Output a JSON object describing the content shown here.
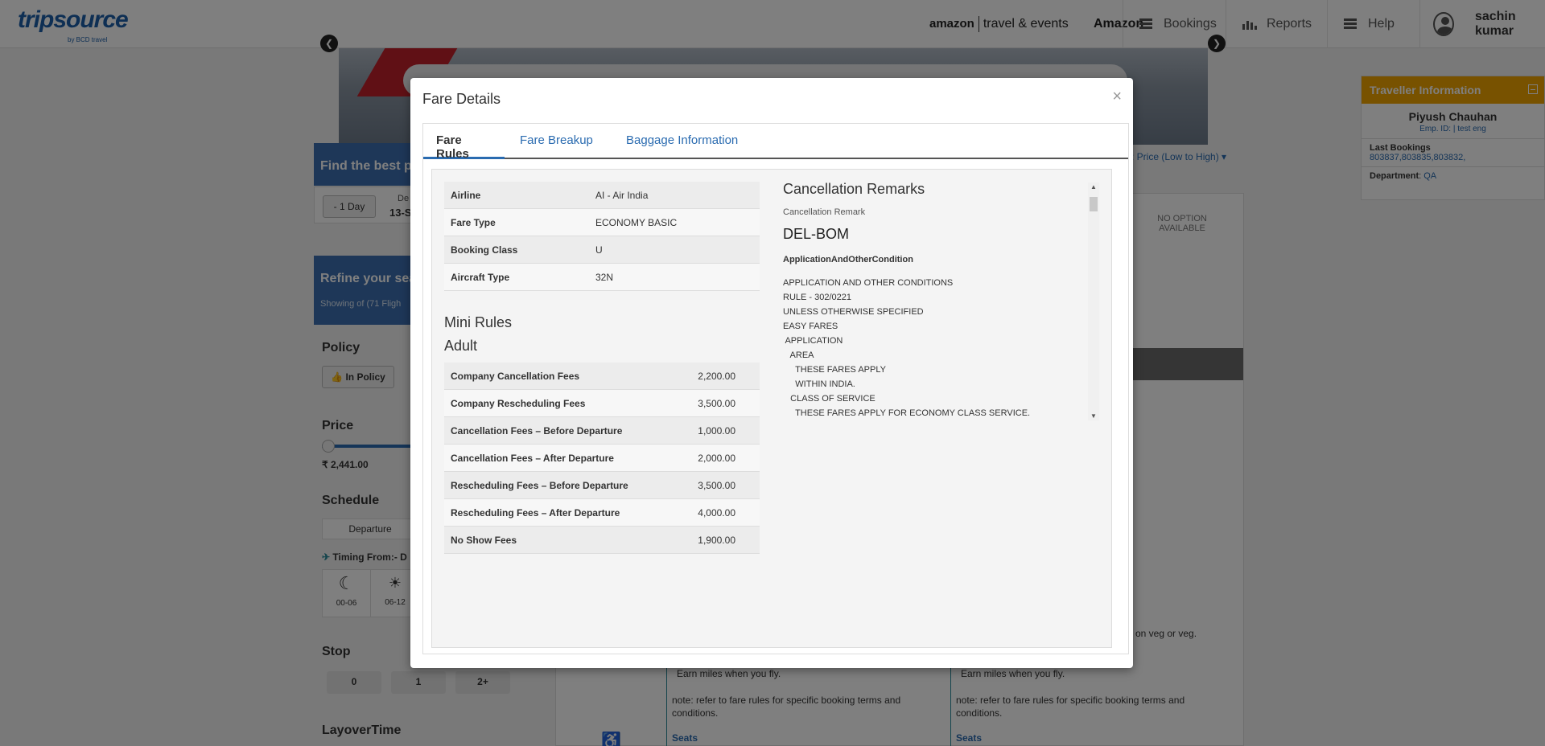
{
  "header": {
    "logo": "tripsource",
    "logo_sub": "by BCD travel",
    "brand_amazon": "amazon",
    "brand_travel": "travel & events",
    "brand_name": "Amazon",
    "nav": [
      "Bookings",
      "Reports",
      "Help"
    ],
    "user": "sachin kumar"
  },
  "background": {
    "find_best": "Find the best pr",
    "one_day": "- 1 Day",
    "date_label": "De",
    "date_value": "13-S",
    "refine": "Refine your sea",
    "showing": "Showing of (71 Fligh",
    "policy": "Policy",
    "in_policy": "In Policy",
    "price": "Price",
    "price_min": "₹ 2,441.00",
    "schedule": "Schedule",
    "departure": "Departure",
    "timing": "Timing From:- D",
    "slot1": "00-06",
    "slot2": "06-12",
    "stop": "Stop",
    "stops": [
      "0",
      "1",
      "2+"
    ],
    "layover": "LayoverTime",
    "sort": "y: Price (Low to High)",
    "no_option": "NO OPTION AVAILABLE",
    "veg": "on veg or veg.",
    "earn": "Earn miles when you fly.",
    "note": "note: refer to fare rules for specific booking terms and conditions.",
    "seats": "Seats",
    "right_card": {
      "title": "Traveller Information",
      "name": "Piyush Chauhan",
      "emp": "Emp. ID: | test eng",
      "last_bookings_label": "Last Bookings",
      "last_bookings": "803837,803835,803832,",
      "department_label": "Department",
      "department": "QA"
    }
  },
  "modal": {
    "title": "Fare Details",
    "close": "×",
    "tabs": [
      "Fare Rules",
      "Fare Breakup",
      "Baggage Information"
    ],
    "info": [
      {
        "k": "Airline",
        "v": "AI - Air India"
      },
      {
        "k": "Fare Type",
        "v": "ECONOMY BASIC"
      },
      {
        "k": "Booking Class",
        "v": "U"
      },
      {
        "k": "Aircraft Type",
        "v": "32N"
      }
    ],
    "mini_rules": "Mini Rules",
    "adult": "Adult",
    "fees": [
      {
        "k": "Company Cancellation Fees",
        "v": "2,200.00"
      },
      {
        "k": "Company Rescheduling Fees",
        "v": "3,500.00"
      },
      {
        "k": "Cancellation Fees – Before Departure",
        "v": "1,000.00"
      },
      {
        "k": "Cancellation Fees – After Departure",
        "v": "2,000.00"
      },
      {
        "k": "Rescheduling Fees – Before Departure",
        "v": "3,500.00"
      },
      {
        "k": "Rescheduling Fees – After Departure",
        "v": "4,000.00"
      },
      {
        "k": "No Show Fees",
        "v": "1,900.00"
      }
    ],
    "remarks": {
      "title": "Cancellation Remarks",
      "sub": "Cancellation Remark",
      "route": "DEL-BOM",
      "section": "ApplicationAndOtherCondition",
      "lines": "APPLICATION AND OTHER CONDITIONS\nRULE - 302/0221\nUNLESS OTHERWISE SPECIFIED\nEASY FARES\n APPLICATION\n   AREA\n     THESE FARES APPLY\n     WITHIN INDIA.\n   CLASS OF SERVICE\n     THESE FARES APPLY FOR ECONOMY CLASS SERVICE."
    }
  }
}
